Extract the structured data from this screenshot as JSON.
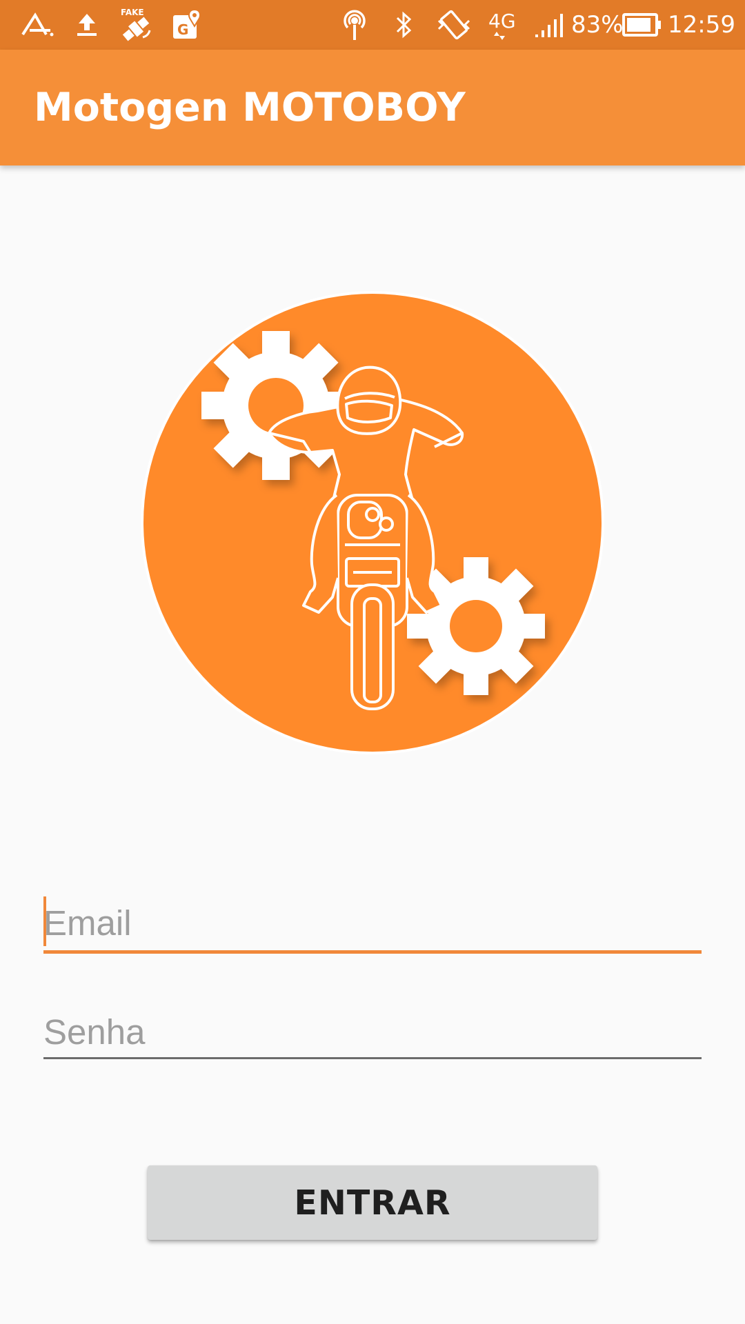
{
  "status_bar": {
    "battery_percent": "83%",
    "network": "4G",
    "time": "12:59",
    "icons": [
      "notification-a-icon",
      "upload-icon",
      "fake-gps-icon",
      "maps-icon",
      "hotspot-icon",
      "bluetooth-icon",
      "vibrate-icon",
      "network-4g-icon",
      "signal-icon",
      "battery-icon"
    ]
  },
  "app_bar": {
    "title": "Motogen MOTOBOY",
    "color": "#f58f38"
  },
  "logo": {
    "icon": "motorcycle-rider-gears-logo",
    "color": "#ff8a2a"
  },
  "form": {
    "email_placeholder": "Email",
    "email_value": "",
    "password_placeholder": "Senha",
    "password_value": "",
    "submit_label": "ENTRAR"
  },
  "colors": {
    "status_bar": "#e27b28",
    "accent": "#f0883a",
    "background": "#fafafa",
    "button": "#d6d7d7"
  }
}
